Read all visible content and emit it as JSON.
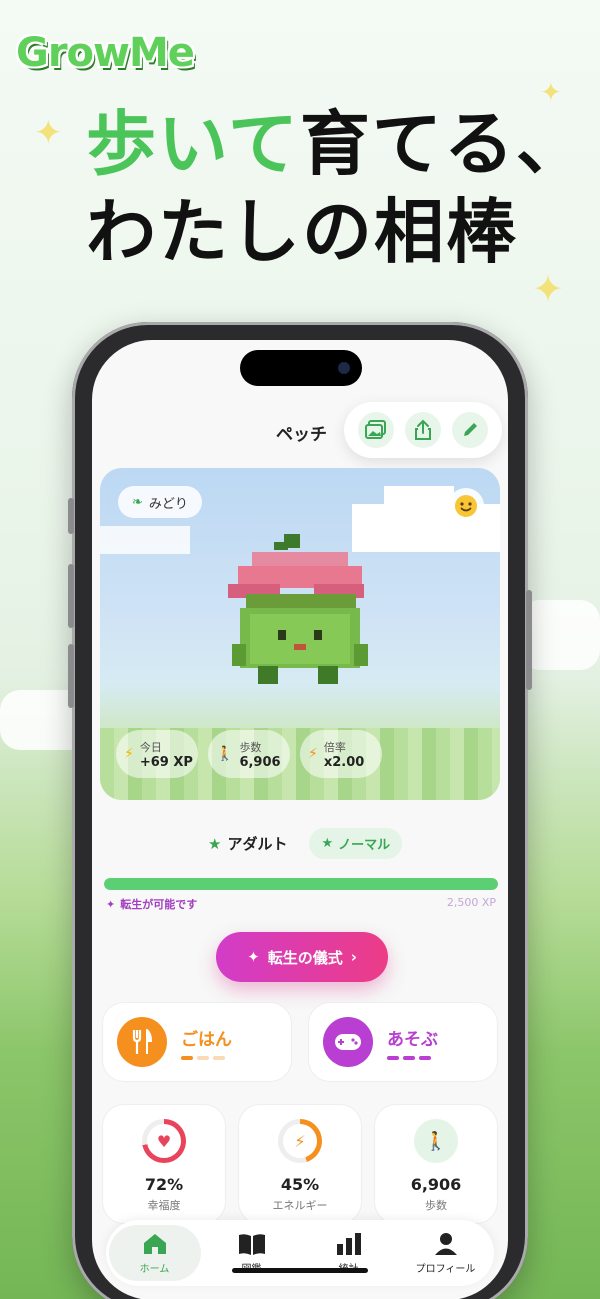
{
  "promo": {
    "logo": "GrowMe",
    "headline_green": "歩いて",
    "headline_rest1": "育てる、",
    "headline_line2": "わたしの相棒"
  },
  "app": {
    "pet_name": "ペッチ",
    "toolbar": {
      "gallery_icon": "image-icon",
      "share_icon": "share-icon",
      "edit_icon": "pencil-icon"
    },
    "hero": {
      "type_tag": "みどり",
      "mood_icon": "smile-emoji",
      "stats": [
        {
          "label": "今日",
          "value": "+69 XP",
          "icon": "lightning-icon"
        },
        {
          "label": "歩数",
          "value": "6,906",
          "icon": "walk-icon"
        },
        {
          "label": "倍率",
          "value": "x2.00",
          "icon": "bolt-icon"
        }
      ]
    },
    "stage": {
      "name": "アダルト",
      "rank": "ノーマル"
    },
    "progress": {
      "fraction": 1.0,
      "note": "転生が可能です",
      "max_label": "2,500 XP"
    },
    "ritual_button": "転生の儀式",
    "actions": [
      {
        "label": "ごはん",
        "color": "#f5901e"
      },
      {
        "label": "あそぶ",
        "color": "#b93fd2"
      }
    ],
    "cards": [
      {
        "value": "72%",
        "label": "幸福度",
        "fraction": 0.72,
        "color": "#e8445b"
      },
      {
        "value": "45%",
        "label": "エネルギー",
        "fraction": 0.45,
        "color": "#f5901e"
      },
      {
        "value": "6,906",
        "label": "歩数",
        "fraction": 0.0,
        "color": "#3aa653"
      }
    ],
    "tabs": [
      {
        "label": "ホーム",
        "icon": "home-icon",
        "active": true
      },
      {
        "label": "図鑑",
        "icon": "book-icon",
        "active": false
      },
      {
        "label": "統計",
        "icon": "bar-chart-icon",
        "active": false
      },
      {
        "label": "プロフィール",
        "icon": "person-icon",
        "active": false
      }
    ]
  },
  "colors": {
    "accent_green": "#4bc45a",
    "ritual_start": "#d23cc9",
    "ritual_end": "#ec3c86"
  }
}
